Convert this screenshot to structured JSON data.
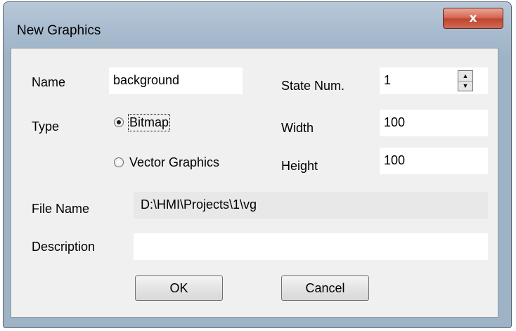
{
  "window": {
    "title": "New Graphics",
    "close_glyph": "x"
  },
  "form": {
    "name_label": "Name",
    "name_value": "background",
    "state_label": "State Num.",
    "state_value": "1",
    "type_label": "Type",
    "type_options": [
      {
        "label": "Bitmap",
        "selected": true
      },
      {
        "label": "Vector Graphics",
        "selected": false
      }
    ],
    "width_label": "Width",
    "width_value": "100",
    "height_label": "Height",
    "height_value": "100",
    "file_label": "File Name",
    "file_value": "D:\\HMI\\Projects\\1\\vg",
    "desc_label": "Description",
    "desc_value": ""
  },
  "buttons": {
    "ok": "OK",
    "cancel": "Cancel"
  },
  "icons": {
    "spin_up": "triangle-up",
    "spin_down": "triangle-down"
  }
}
